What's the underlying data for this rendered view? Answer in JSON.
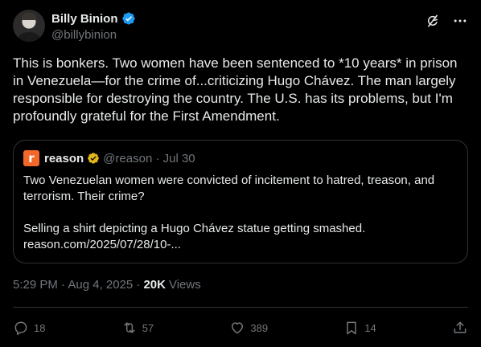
{
  "author": {
    "display_name": "Billy Binion",
    "handle": "@billybinion"
  },
  "tweet": {
    "text": "This is bonkers. Two women have been sentenced to *10 years* in prison in Venezuela—for the crime of...criticizing Hugo Chávez. The man largely responsible for destroying the country. The U.S. has its problems, but I'm profoundly grateful for the First Amendment.",
    "timestamp": "5:29 PM · Aug 4, 2025 ·",
    "views_count": "20K",
    "views_label": "Views"
  },
  "quote": {
    "logo_letter": "r",
    "name": "reason",
    "meta": "@reason · Jul 30",
    "text": "Two Venezuelan women were convicted of incitement to hatred, treason, and terrorism. Their crime?\n\nSelling a shirt depicting a Hugo Chávez statue getting smashed.\nreason.com/2025/07/28/10-..."
  },
  "actions": {
    "reply_count": "18",
    "repost_count": "57",
    "like_count": "389",
    "bookmark_count": "14"
  },
  "colors": {
    "background": "#000000",
    "text": "#e7e9ea",
    "muted": "#71767b",
    "verified_blue": "#1d9bf0",
    "verified_gold": "#e2b719",
    "reason_orange": "#f2682a",
    "border": "#2f3336"
  }
}
